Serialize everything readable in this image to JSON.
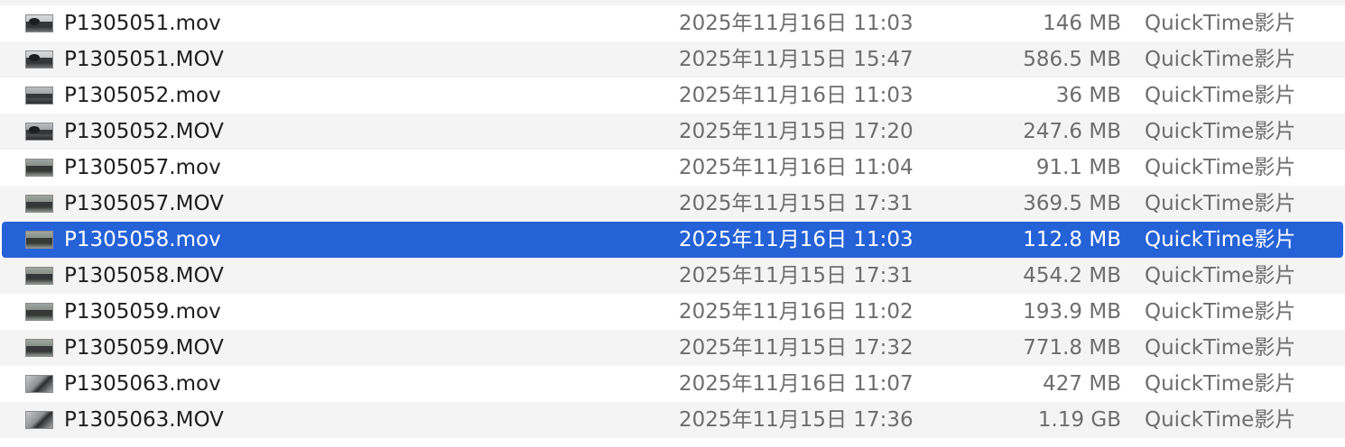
{
  "window": {
    "view": "list"
  },
  "colors": {
    "selection": "#2562d8",
    "stripe": "#f4f4f5",
    "name_text": "#1e1e1e",
    "secondary_text": "#6d6d6d"
  },
  "files": [
    {
      "name": "P1305051.mov",
      "date": "2025年11月16日 11:03",
      "size": "146 MB",
      "kind": "QuickTime影片",
      "thumbnail": "video-thumbnail-icon",
      "selected": false
    },
    {
      "name": "P1305051.MOV",
      "date": "2025年11月15日 15:47",
      "size": "586.5 MB",
      "kind": "QuickTime影片",
      "thumbnail": "video-thumbnail-icon",
      "selected": false
    },
    {
      "name": "P1305052.mov",
      "date": "2025年11月16日 11:03",
      "size": "36 MB",
      "kind": "QuickTime影片",
      "thumbnail": "video-thumbnail-icon",
      "selected": false
    },
    {
      "name": "P1305052.MOV",
      "date": "2025年11月15日 17:20",
      "size": "247.6 MB",
      "kind": "QuickTime影片",
      "thumbnail": "video-thumbnail-icon",
      "selected": false
    },
    {
      "name": "P1305057.mov",
      "date": "2025年11月16日 11:04",
      "size": "91.1 MB",
      "kind": "QuickTime影片",
      "thumbnail": "video-thumbnail-icon",
      "selected": false
    },
    {
      "name": "P1305057.MOV",
      "date": "2025年11月15日 17:31",
      "size": "369.5 MB",
      "kind": "QuickTime影片",
      "thumbnail": "video-thumbnail-icon",
      "selected": false
    },
    {
      "name": "P1305058.mov",
      "date": "2025年11月16日 11:03",
      "size": "112.8 MB",
      "kind": "QuickTime影片",
      "thumbnail": "video-thumbnail-icon",
      "selected": true
    },
    {
      "name": "P1305058.MOV",
      "date": "2025年11月15日 17:31",
      "size": "454.2 MB",
      "kind": "QuickTime影片",
      "thumbnail": "video-thumbnail-icon",
      "selected": false
    },
    {
      "name": "P1305059.mov",
      "date": "2025年11月16日 11:02",
      "size": "193.9 MB",
      "kind": "QuickTime影片",
      "thumbnail": "video-thumbnail-icon",
      "selected": false
    },
    {
      "name": "P1305059.MOV",
      "date": "2025年11月15日 17:32",
      "size": "771.8 MB",
      "kind": "QuickTime影片",
      "thumbnail": "video-thumbnail-icon",
      "selected": false
    },
    {
      "name": "P1305063.mov",
      "date": "2025年11月16日 11:07",
      "size": "427 MB",
      "kind": "QuickTime影片",
      "thumbnail": "video-thumbnail-icon",
      "selected": false
    },
    {
      "name": "P1305063.MOV",
      "date": "2025年11月15日 17:36",
      "size": "1.19 GB",
      "kind": "QuickTime影片",
      "thumbnail": "video-thumbnail-icon",
      "selected": false
    }
  ]
}
